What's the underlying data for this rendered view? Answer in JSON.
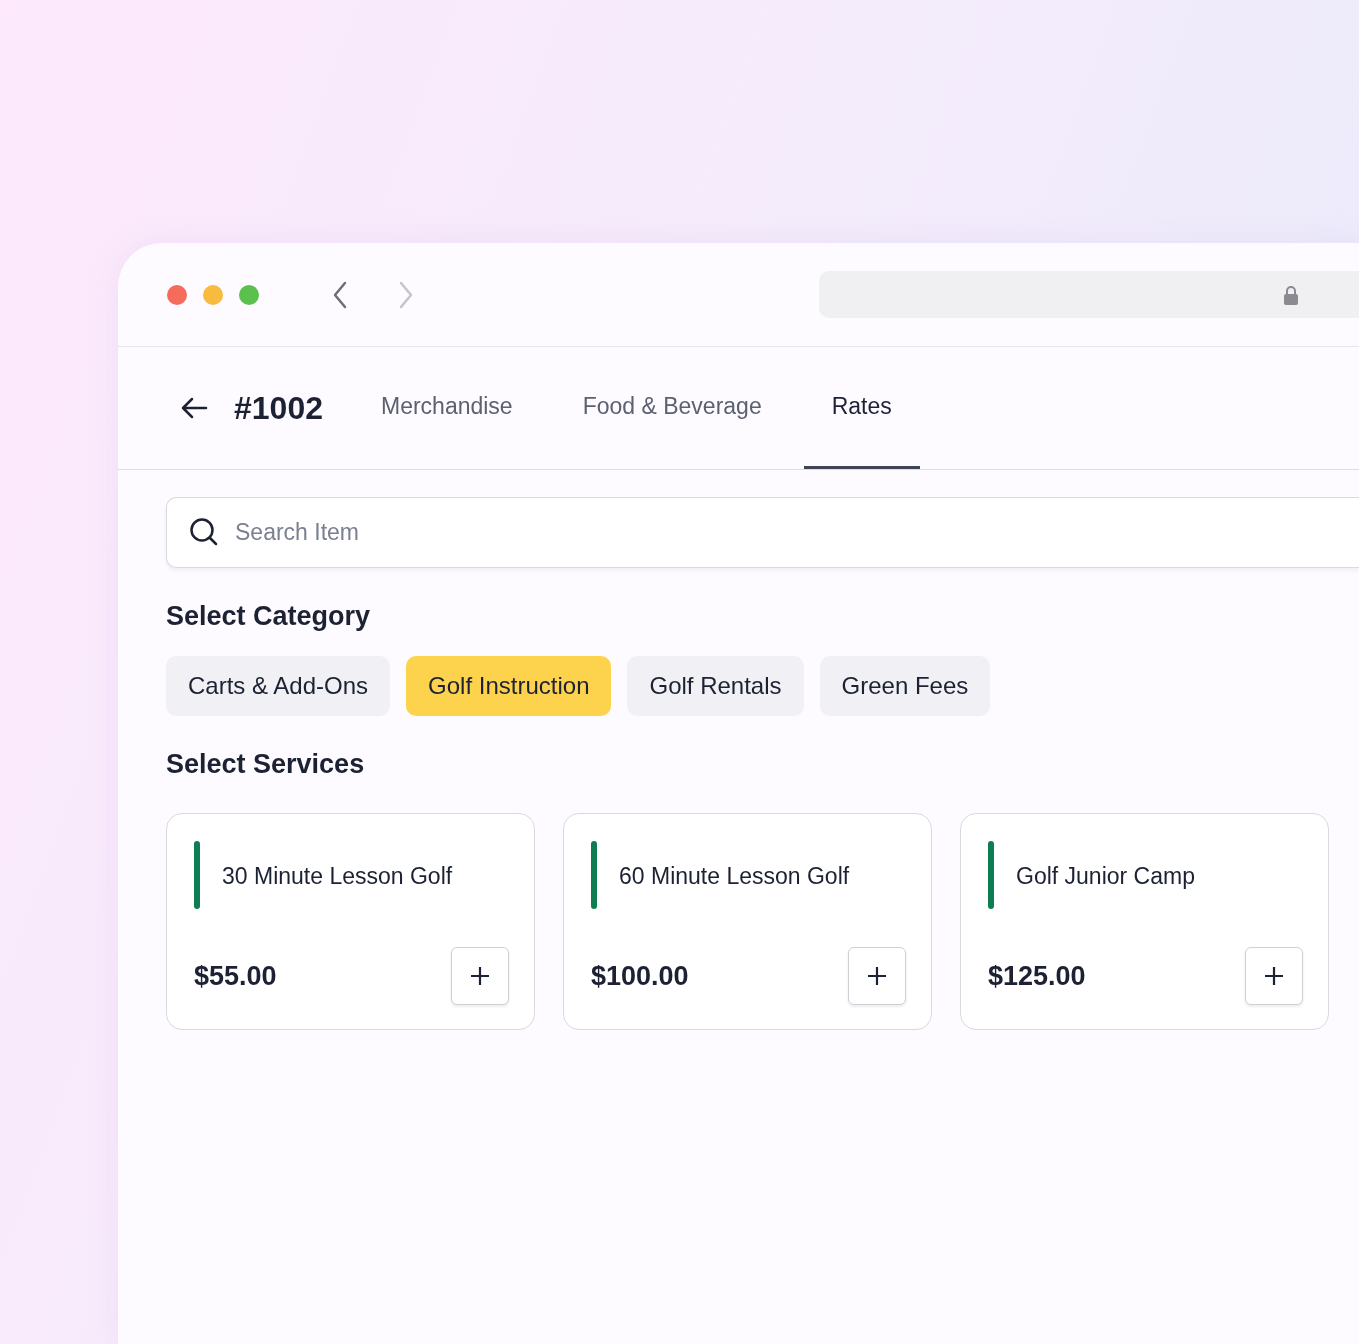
{
  "browser": {
    "nav_buttons": [
      {
        "kind": "back",
        "disabled": false
      },
      {
        "kind": "forward",
        "disabled": true
      }
    ]
  },
  "header": {
    "order_number": "#1002",
    "tabs": [
      {
        "label": "Merchandise",
        "selected": false
      },
      {
        "label": "Food & Beverage",
        "selected": false
      },
      {
        "label": "Rates",
        "selected": true
      }
    ]
  },
  "search": {
    "placeholder": "Search Item"
  },
  "category_heading": "Select Category",
  "categories": [
    {
      "label": "Carts & Add-Ons",
      "selected": false
    },
    {
      "label": "Golf Instruction",
      "selected": true
    },
    {
      "label": "Golf Rentals",
      "selected": false
    },
    {
      "label": "Green Fees",
      "selected": false
    }
  ],
  "services_heading": "Select Services",
  "services": [
    {
      "name": "30 Minute Lesson Golf",
      "price": "$55.00"
    },
    {
      "name": "60 Minute Lesson Golf",
      "price": "$100.00"
    },
    {
      "name": "Golf Junior Camp",
      "price": "$125.00"
    }
  ]
}
